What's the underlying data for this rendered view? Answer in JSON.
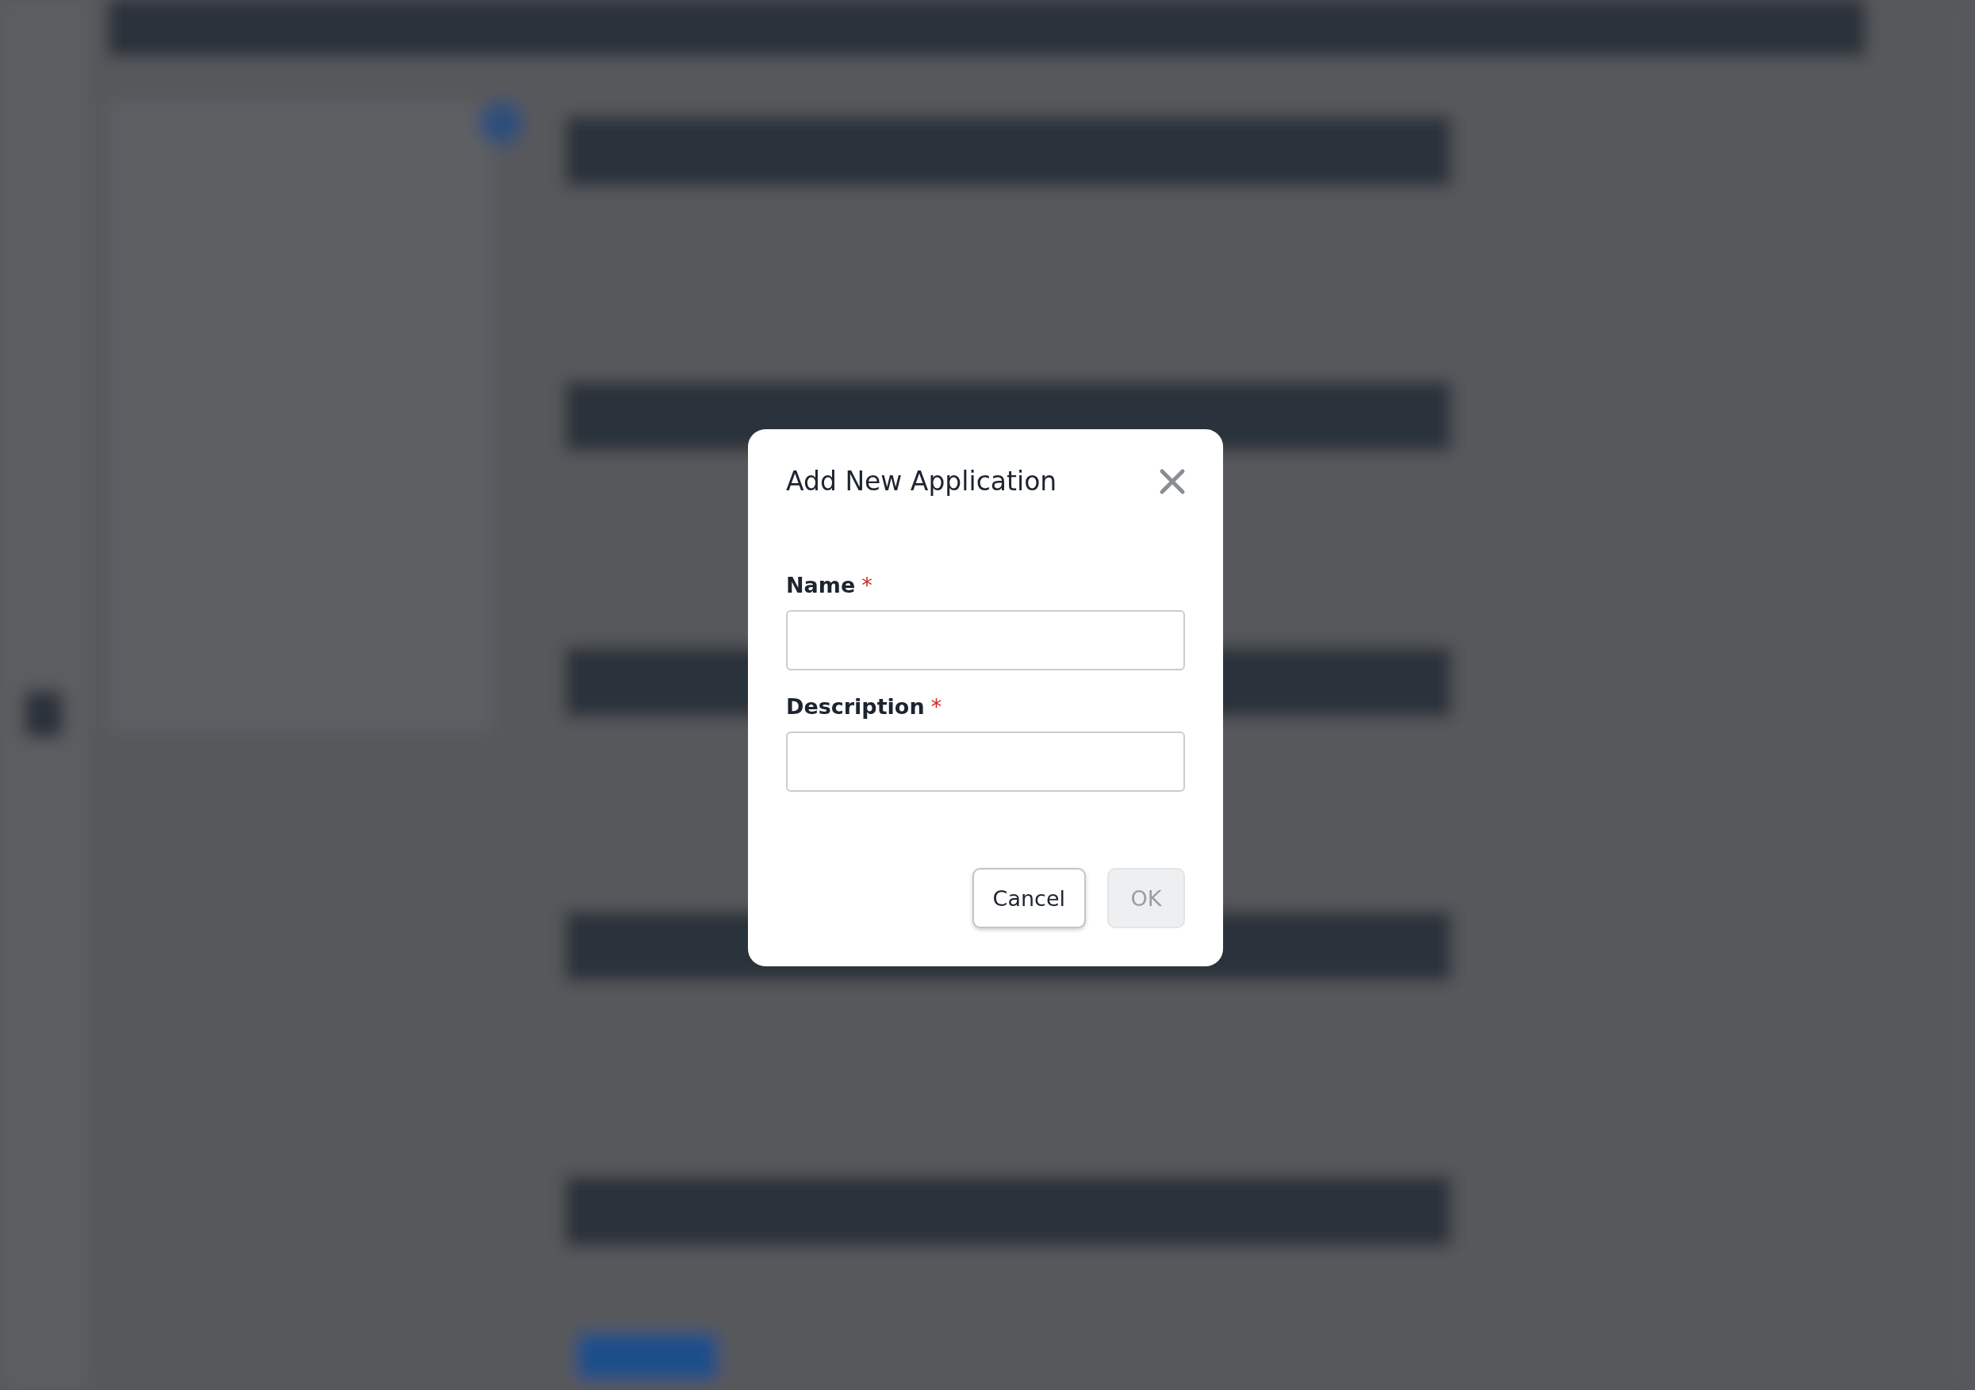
{
  "dialog": {
    "title": "Add New Application",
    "fields": [
      {
        "label": "Name",
        "required_mark": "*",
        "required": true
      },
      {
        "label": "Description",
        "required_mark": "*",
        "required": true
      }
    ],
    "buttons": [
      {
        "label": "Cancel",
        "kind": "secondary",
        "disabled": false
      },
      {
        "label": "OK",
        "kind": "primary",
        "disabled": true
      }
    ]
  }
}
